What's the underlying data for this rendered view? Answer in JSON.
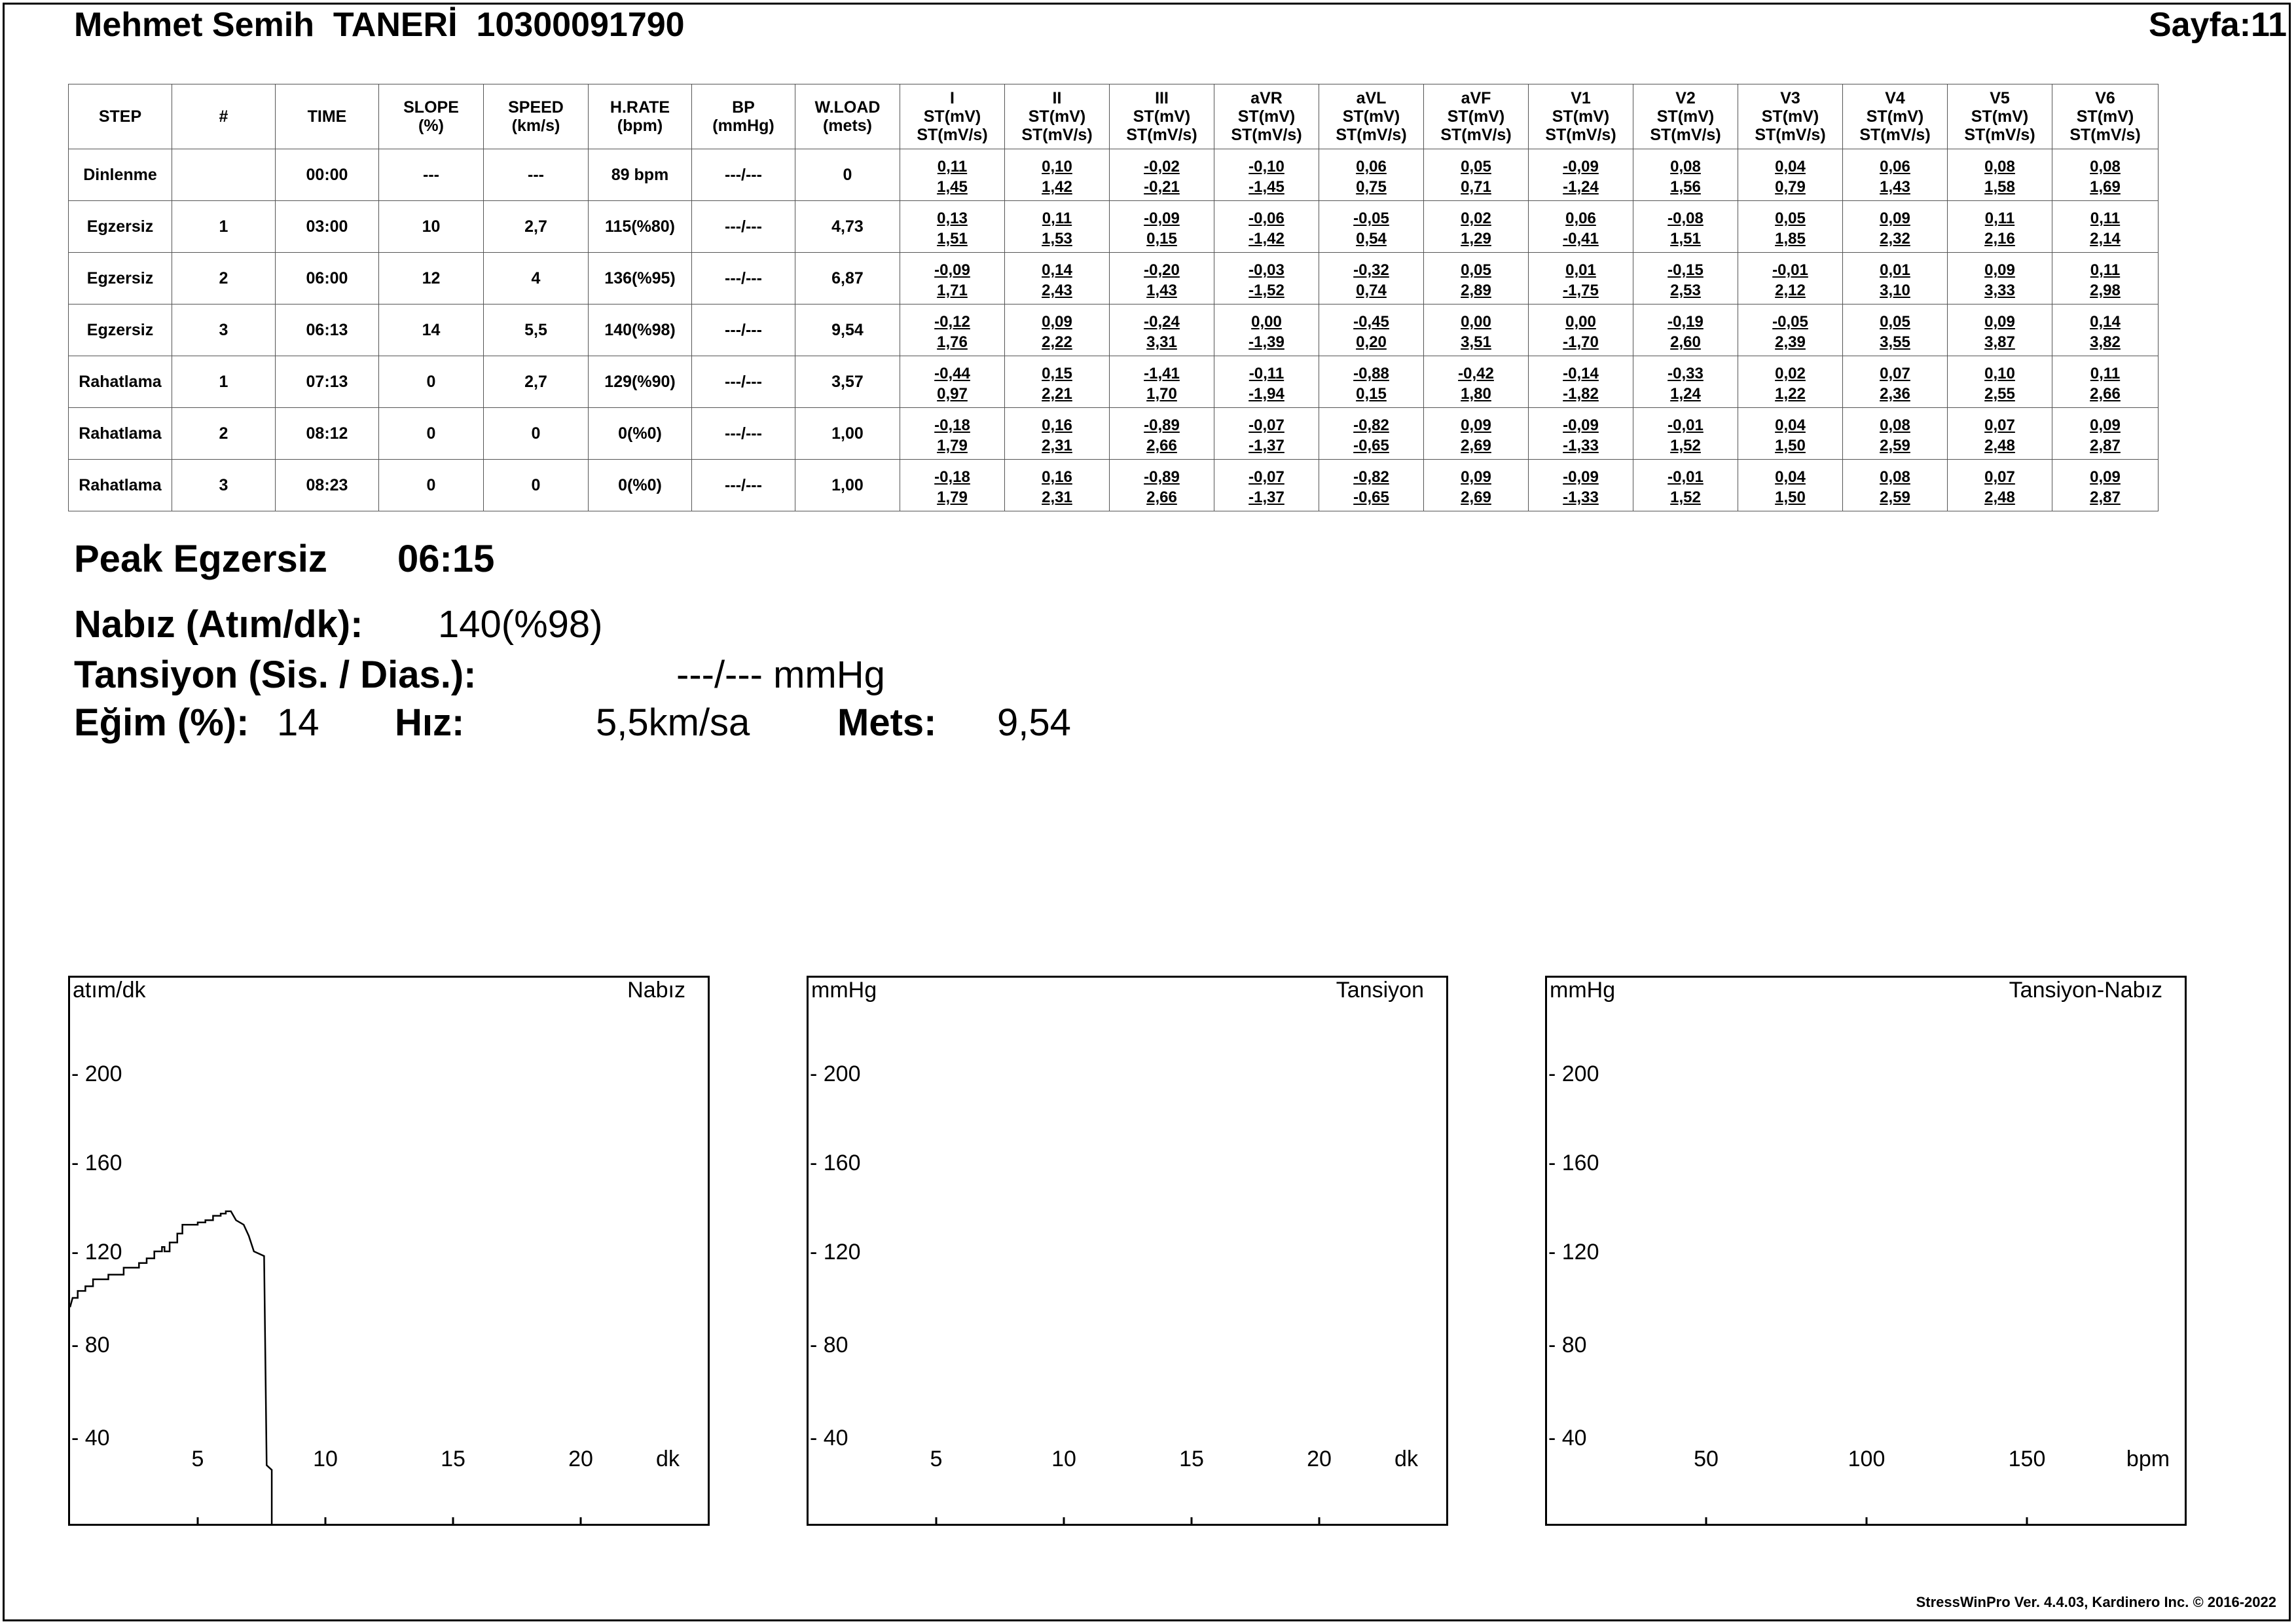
{
  "header": {
    "patient": "Mehmet Semih  TANERİ  10300091790",
    "page": "Sayfa:11"
  },
  "table": {
    "columns": [
      [
        "STEP"
      ],
      [
        "#"
      ],
      [
        "TIME"
      ],
      [
        "SLOPE",
        "(%)"
      ],
      [
        "SPEED",
        "(km/s)"
      ],
      [
        "H.RATE",
        "(bpm)"
      ],
      [
        "BP",
        "(mmHg)"
      ],
      [
        "W.LOAD",
        "(mets)"
      ],
      [
        "I",
        "ST(mV)",
        "ST(mV/s)"
      ],
      [
        "II",
        "ST(mV)",
        "ST(mV/s)"
      ],
      [
        "III",
        "ST(mV)",
        "ST(mV/s)"
      ],
      [
        "aVR",
        "ST(mV)",
        "ST(mV/s)"
      ],
      [
        "aVL",
        "ST(mV)",
        "ST(mV/s)"
      ],
      [
        "aVF",
        "ST(mV)",
        "ST(mV/s)"
      ],
      [
        "V1",
        "ST(mV)",
        "ST(mV/s)"
      ],
      [
        "V2",
        "ST(mV)",
        "ST(mV/s)"
      ],
      [
        "V3",
        "ST(mV)",
        "ST(mV/s)"
      ],
      [
        "V4",
        "ST(mV)",
        "ST(mV/s)"
      ],
      [
        "V5",
        "ST(mV)",
        "ST(mV/s)"
      ],
      [
        "V6",
        "ST(mV)",
        "ST(mV/s)"
      ]
    ],
    "rows": [
      {
        "step": "Dinlenme",
        "num": "",
        "time": "00:00",
        "slope": "---",
        "speed": "---",
        "hrate": "89 bpm",
        "bp": "---/---",
        "wload": "0",
        "leads": [
          [
            "0,11",
            "1,45"
          ],
          [
            "0,10",
            "1,42"
          ],
          [
            "-0,02",
            "-0,21"
          ],
          [
            "-0,10",
            "-1,45"
          ],
          [
            "0,06",
            "0,75"
          ],
          [
            "0,05",
            "0,71"
          ],
          [
            "-0,09",
            "-1,24"
          ],
          [
            "0,08",
            "1,56"
          ],
          [
            "0,04",
            "0,79"
          ],
          [
            "0,06",
            "1,43"
          ],
          [
            "0,08",
            "1,58"
          ],
          [
            "0,08",
            "1,69"
          ]
        ]
      },
      {
        "step": "Egzersiz",
        "num": "1",
        "time": "03:00",
        "slope": "10",
        "speed": "2,7",
        "hrate": "115(%80)",
        "bp": "---/---",
        "wload": "4,73",
        "leads": [
          [
            "0,13",
            "1,51"
          ],
          [
            "0,11",
            "1,53"
          ],
          [
            "-0,09",
            "0,15"
          ],
          [
            "-0,06",
            "-1,42"
          ],
          [
            "-0,05",
            "0,54"
          ],
          [
            "0,02",
            "1,29"
          ],
          [
            "0,06",
            "-0,41"
          ],
          [
            "-0,08",
            "1,51"
          ],
          [
            "0,05",
            "1,85"
          ],
          [
            "0,09",
            "2,32"
          ],
          [
            "0,11",
            "2,16"
          ],
          [
            "0,11",
            "2,14"
          ]
        ]
      },
      {
        "step": "Egzersiz",
        "num": "2",
        "time": "06:00",
        "slope": "12",
        "speed": "4",
        "hrate": "136(%95)",
        "bp": "---/---",
        "wload": "6,87",
        "leads": [
          [
            "-0,09",
            "1,71"
          ],
          [
            "0,14",
            "2,43"
          ],
          [
            "-0,20",
            "1,43"
          ],
          [
            "-0,03",
            "-1,52"
          ],
          [
            "-0,32",
            "0,74"
          ],
          [
            "0,05",
            "2,89"
          ],
          [
            "0,01",
            "-1,75"
          ],
          [
            "-0,15",
            "2,53"
          ],
          [
            "-0,01",
            "2,12"
          ],
          [
            "0,01",
            "3,10"
          ],
          [
            "0,09",
            "3,33"
          ],
          [
            "0,11",
            "2,98"
          ]
        ]
      },
      {
        "step": "Egzersiz",
        "num": "3",
        "time": "06:13",
        "slope": "14",
        "speed": "5,5",
        "hrate": "140(%98)",
        "bp": "---/---",
        "wload": "9,54",
        "leads": [
          [
            "-0,12",
            "1,76"
          ],
          [
            "0,09",
            "2,22"
          ],
          [
            "-0,24",
            "3,31"
          ],
          [
            "0,00",
            "-1,39"
          ],
          [
            "-0,45",
            "0,20"
          ],
          [
            "0,00",
            "3,51"
          ],
          [
            "0,00",
            "-1,70"
          ],
          [
            "-0,19",
            "2,60"
          ],
          [
            "-0,05",
            "2,39"
          ],
          [
            "0,05",
            "3,55"
          ],
          [
            "0,09",
            "3,87"
          ],
          [
            "0,14",
            "3,82"
          ]
        ]
      },
      {
        "step": "Rahatlama",
        "num": "1",
        "time": "07:13",
        "slope": "0",
        "speed": "2,7",
        "hrate": "129(%90)",
        "bp": "---/---",
        "wload": "3,57",
        "leads": [
          [
            "-0,44",
            "0,97"
          ],
          [
            "0,15",
            "2,21"
          ],
          [
            "-1,41",
            "1,70"
          ],
          [
            "-0,11",
            "-1,94"
          ],
          [
            "-0,88",
            "0,15"
          ],
          [
            "-0,42",
            "1,80"
          ],
          [
            "-0,14",
            "-1,82"
          ],
          [
            "-0,33",
            "1,24"
          ],
          [
            "0,02",
            "1,22"
          ],
          [
            "0,07",
            "2,36"
          ],
          [
            "0,10",
            "2,55"
          ],
          [
            "0,11",
            "2,66"
          ]
        ]
      },
      {
        "step": "Rahatlama",
        "num": "2",
        "time": "08:12",
        "slope": "0",
        "speed": "0",
        "hrate": "0(%0)",
        "bp": "---/---",
        "wload": "1,00",
        "leads": [
          [
            "-0,18",
            "1,79"
          ],
          [
            "0,16",
            "2,31"
          ],
          [
            "-0,89",
            "2,66"
          ],
          [
            "-0,07",
            "-1,37"
          ],
          [
            "-0,82",
            "-0,65"
          ],
          [
            "0,09",
            "2,69"
          ],
          [
            "-0,09",
            "-1,33"
          ],
          [
            "-0,01",
            "1,52"
          ],
          [
            "0,04",
            "1,50"
          ],
          [
            "0,08",
            "2,59"
          ],
          [
            "0,07",
            "2,48"
          ],
          [
            "0,09",
            "2,87"
          ]
        ]
      },
      {
        "step": "Rahatlama",
        "num": "3",
        "time": "08:23",
        "slope": "0",
        "speed": "0",
        "hrate": "0(%0)",
        "bp": "---/---",
        "wload": "1,00",
        "leads": [
          [
            "-0,18",
            "1,79"
          ],
          [
            "0,16",
            "2,31"
          ],
          [
            "-0,89",
            "2,66"
          ],
          [
            "-0,07",
            "-1,37"
          ],
          [
            "-0,82",
            "-0,65"
          ],
          [
            "0,09",
            "2,69"
          ],
          [
            "-0,09",
            "-1,33"
          ],
          [
            "-0,01",
            "1,52"
          ],
          [
            "0,04",
            "1,50"
          ],
          [
            "0,08",
            "2,59"
          ],
          [
            "0,07",
            "2,48"
          ],
          [
            "0,09",
            "2,87"
          ]
        ]
      }
    ]
  },
  "summary": {
    "peak_label": "Peak Egzersiz",
    "peak_time": "06:15",
    "pulse_label": "Nabız (Atım/dk):",
    "pulse_value": "140(%98)",
    "bp_label": "Tansiyon (Sis. / Dias.):",
    "bp_value": "---/--- mmHg",
    "slope_label": "Eğim (%):",
    "slope_value": "14",
    "speed_label": "Hız:",
    "speed_value": "5,5km/sa",
    "mets_label": "Mets:",
    "mets_value": "9,54"
  },
  "chart_data": [
    {
      "type": "line",
      "title": "Nabız",
      "ylabel": "atım/dk",
      "xlabel": "dk",
      "yticks": [
        200,
        160,
        120,
        80,
        40
      ],
      "xticks": [
        5,
        10,
        15,
        20
      ],
      "xlim": [
        0,
        25
      ],
      "ylim": [
        25,
        235
      ],
      "series": [
        {
          "x": [
            0.0,
            0.1,
            0.3,
            0.3,
            0.6,
            0.6,
            0.9,
            0.9,
            1.5,
            1.5,
            2.1,
            2.1,
            2.7,
            2.7,
            3.0,
            3.0,
            3.3,
            3.3,
            3.6,
            3.6,
            3.7,
            3.7,
            3.9,
            3.9,
            4.2,
            4.2,
            4.4,
            4.4,
            5.0,
            5.0,
            5.3,
            5.3,
            5.6,
            5.6,
            5.9,
            5.9,
            6.1,
            6.1,
            6.3,
            6.5,
            6.5,
            6.8,
            6.8,
            7.0,
            7.0,
            7.2,
            7.2,
            7.6,
            7.7,
            7.9,
            7.9
          ],
          "y": [
            96,
            100,
            100,
            103,
            103,
            105,
            105,
            108,
            108,
            110,
            110,
            113,
            113,
            115,
            115,
            117,
            117,
            120,
            120,
            122,
            122,
            120,
            120,
            124,
            124,
            128,
            128,
            132,
            132,
            133,
            133,
            134,
            134,
            136,
            136,
            137,
            137,
            138,
            138,
            134,
            134,
            132,
            132,
            127,
            127,
            120,
            120,
            118,
            28,
            26,
            0
          ]
        }
      ]
    },
    {
      "type": "line",
      "title": "Tansiyon",
      "ylabel": "mmHg",
      "xlabel": "dk",
      "yticks": [
        200,
        160,
        120,
        80,
        40
      ],
      "xticks": [
        5,
        10,
        15,
        20
      ],
      "xlim": [
        0,
        25
      ],
      "ylim": [
        25,
        235
      ],
      "series": []
    },
    {
      "type": "line",
      "title": "Tansiyon-Nabız",
      "ylabel": "mmHg",
      "xlabel": "bpm",
      "yticks": [
        200,
        160,
        120,
        80,
        40
      ],
      "xticks": [
        50,
        100,
        150
      ],
      "xlim": [
        0,
        200
      ],
      "ylim": [
        25,
        235
      ],
      "series": []
    }
  ],
  "footer": "StressWinPro Ver. 4.4.03,  Kardinero Inc. © 2016-2022"
}
